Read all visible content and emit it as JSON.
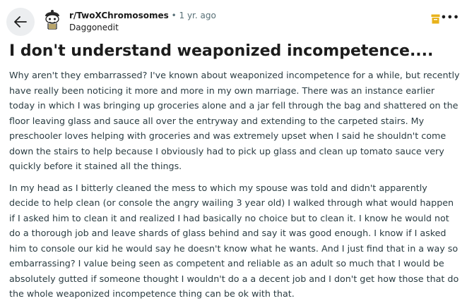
{
  "header": {
    "subreddit": "r/TwoXChromosomes",
    "separator": "•",
    "time_ago": "1 yr. ago",
    "username": "Daggonedit"
  },
  "post": {
    "title": "I don't understand weaponized incompetence....",
    "paragraphs": [
      "Why aren't they embarrassed? I've known about weaponized incompetence for a while, but recently have really been noticing it more and more in my own marriage. There was an instance earlier today in which I was bringing up groceries alone and a jar fell through the bag and shattered on the floor leaving glass and sauce all over the entryway and extending to the carpeted stairs. My preschooler loves helping with groceries and was extremely upset when I said he shouldn't come down the stairs to help because I obviously had to pick up glass and clean up tomato sauce very quickly before it stained all the things.",
      "In my head as I bitterly cleaned the mess to which my spouse was told and didn't apparently decide to help clean (or console the angry wailing 3 year old) I walked through what would happen if I asked him to clean it and realized I had basically no choice but to clean it. I know he would not do a thorough job and leave shards of glass behind and say it was good enough. I know if I asked him to console our kid he would say he doesn't know what he wants. And I just find that in a way so embarrassing? I value being seen as competent and reliable as an adult so much that I would be absolutely gutted if someone thought I wouldn't do a a decent job and I don't get how those that do the whole weaponized incompetence thing can be ok with that."
    ]
  },
  "icons": {
    "back": "back-arrow-icon",
    "avatar": "subreddit-avatar-icon",
    "save": "save-bookmark-icon",
    "more": "more-options-icon"
  },
  "colors": {
    "back_bg": "#eceef0",
    "save_icon": "#e8b21a",
    "meta_gray": "#576f76"
  }
}
